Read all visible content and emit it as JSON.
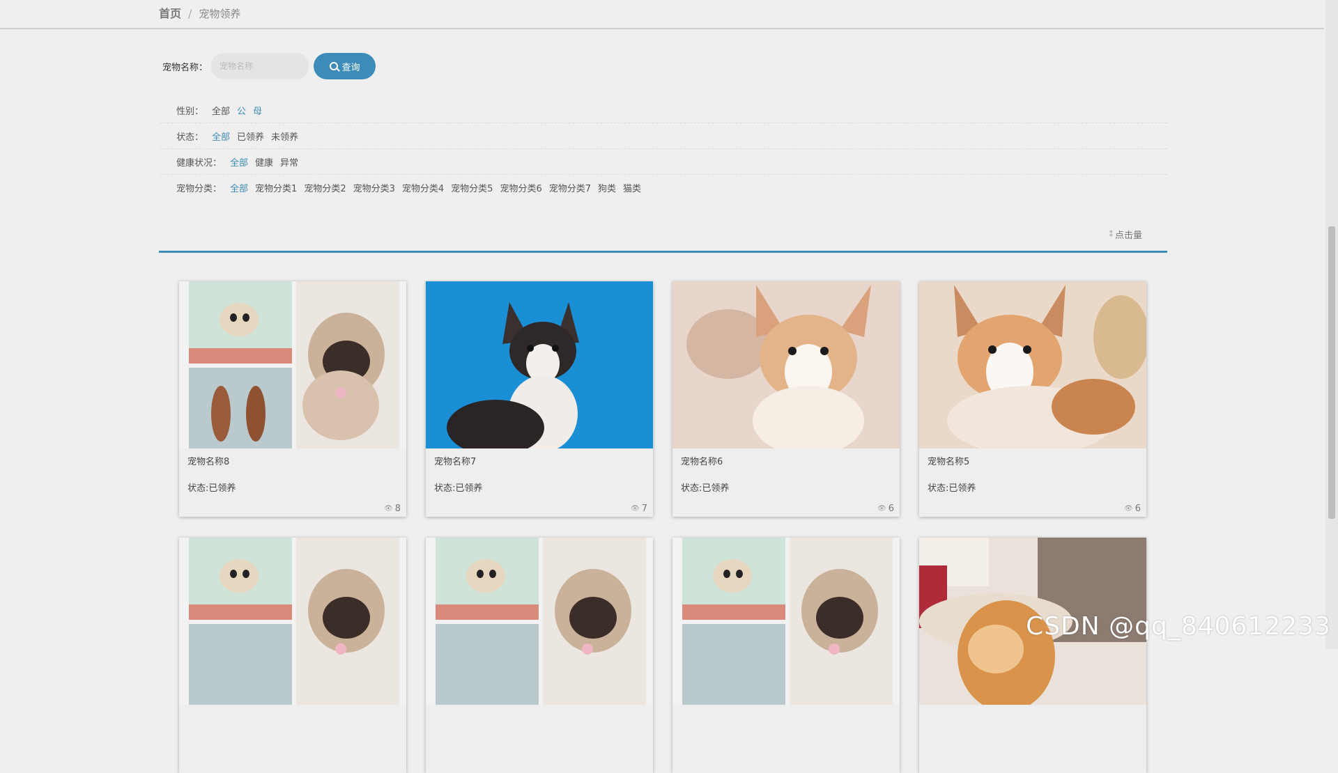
{
  "breadcrumb": {
    "home": "首页",
    "separator": "/",
    "current": "宠物领养"
  },
  "search": {
    "label": "宠物名称：",
    "placeholder": "宠物名称",
    "button_label": "查询"
  },
  "filters": {
    "gender": {
      "title": "性别：",
      "options": [
        "全部",
        "公",
        "母"
      ]
    },
    "status": {
      "title": "状态：",
      "options": [
        "全部",
        "已领养",
        "未领养"
      ]
    },
    "health": {
      "title": "健康状况：",
      "options": [
        "全部",
        "健康",
        "异常"
      ]
    },
    "category": {
      "title": "宠物分类：",
      "options": [
        "全部",
        "宠物分类1",
        "宠物分类2",
        "宠物分类3",
        "宠物分类4",
        "宠物分类5",
        "宠物分类6",
        "宠物分类7",
        "狗类",
        "猫类"
      ]
    }
  },
  "sort": {
    "label": "点击量"
  },
  "cards": [
    {
      "name": "宠物名称8",
      "status": "状态:已领养",
      "views": "8"
    },
    {
      "name": "宠物名称7",
      "status": "状态:已领养",
      "views": "7"
    },
    {
      "name": "宠物名称6",
      "status": "状态:已领养",
      "views": "6"
    },
    {
      "name": "宠物名称5",
      "status": "状态:已领养",
      "views": "6"
    },
    {
      "name": "",
      "status": "",
      "views": ""
    },
    {
      "name": "",
      "status": "",
      "views": ""
    },
    {
      "name": "",
      "status": "",
      "views": ""
    },
    {
      "name": "",
      "status": "",
      "views": ""
    }
  ],
  "watermark": "CSDN @qq_840612233",
  "colors": {
    "accent": "#3d8bb8",
    "background": "#efefef"
  }
}
